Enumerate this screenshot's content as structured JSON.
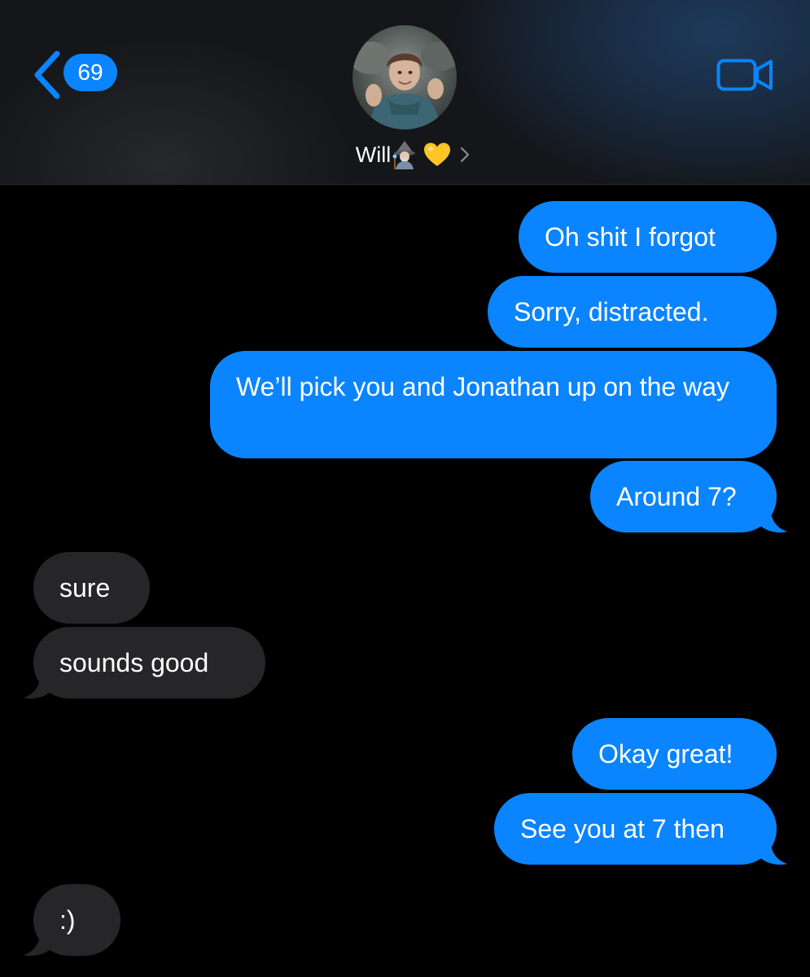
{
  "header": {
    "back_badge": "69",
    "contact_name": "Will",
    "icons": {
      "back": "chevron-left-icon",
      "video": "video-camera-icon",
      "wizard": "wizard-emoji",
      "heart": "yellow-heart-emoji",
      "disclosure": "chevron-right-icon"
    }
  },
  "colors": {
    "sent_bubble": "#0a84ff",
    "received_bubble": "#262628",
    "background": "#000000",
    "accent": "#0a84ff"
  },
  "messages": [
    {
      "sender": "me",
      "text": "Oh shit I forgot"
    },
    {
      "sender": "me",
      "text": "Sorry, distracted."
    },
    {
      "sender": "me",
      "text": "We’ll pick you and Jonathan up on the way"
    },
    {
      "sender": "me",
      "text": "Around 7?"
    },
    {
      "sender": "them",
      "text": "sure"
    },
    {
      "sender": "them",
      "text": "sounds good"
    },
    {
      "sender": "me",
      "text": "Okay great!"
    },
    {
      "sender": "me",
      "text": "See you at 7 then"
    },
    {
      "sender": "them",
      "text": ":)"
    }
  ]
}
